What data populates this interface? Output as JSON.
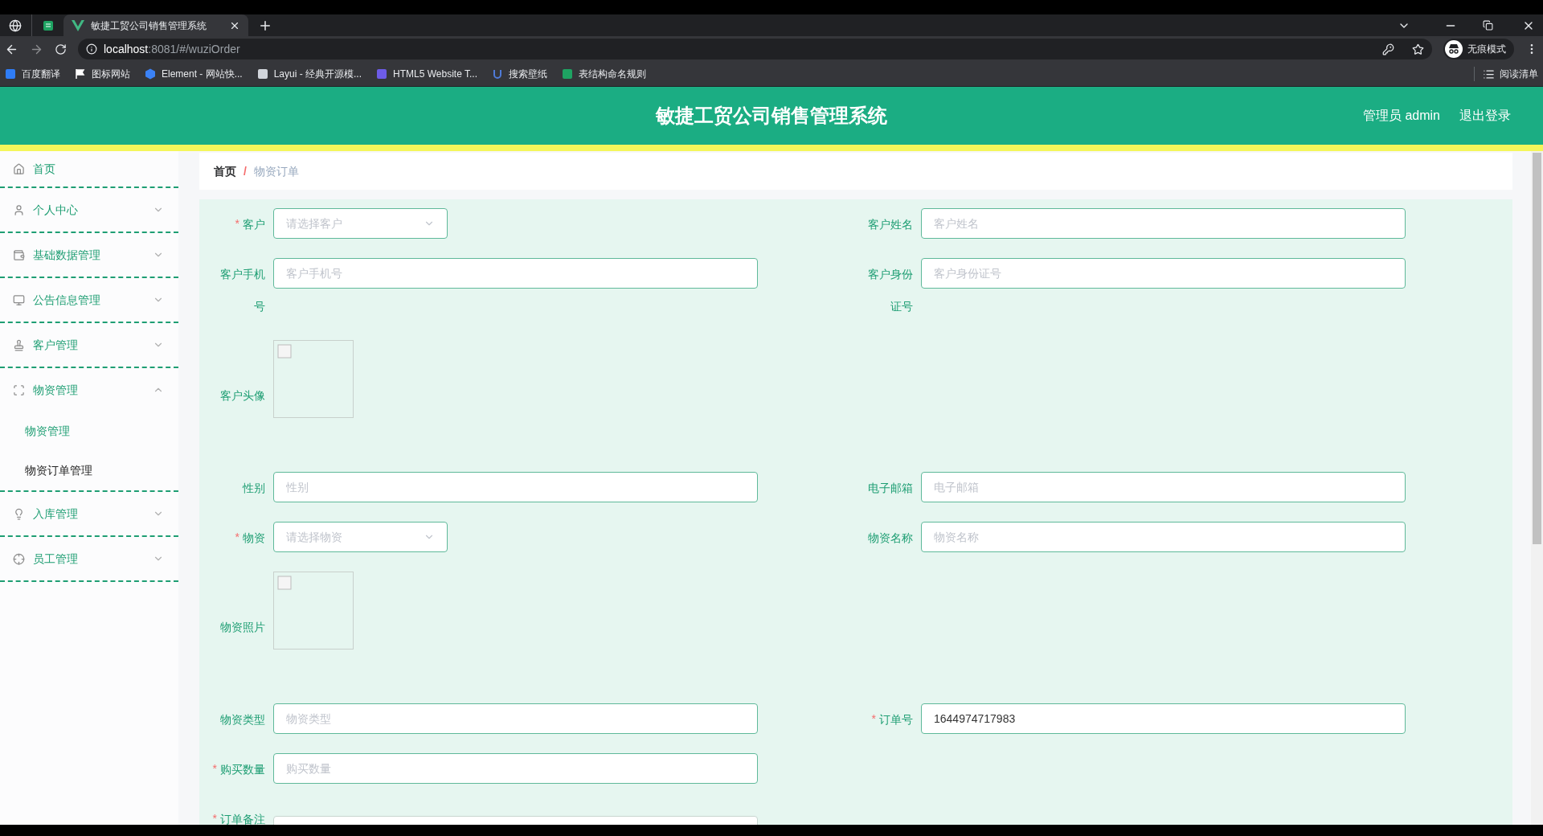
{
  "browser": {
    "tabs": [
      {
        "kind": "pinned",
        "selected": false
      },
      {
        "kind": "page",
        "title": "敏捷工贸公司销售管理系统",
        "selected": true
      }
    ],
    "url_host": "localhost",
    "url_path": ":8081/#/wuziOrder",
    "profile_label": "无痕模式",
    "bookmarks": [
      {
        "label": "百度翻译"
      },
      {
        "label": "图标网站"
      },
      {
        "label": "Element - 网站快..."
      },
      {
        "label": "Layui - 经典开源模..."
      },
      {
        "label": "HTML5 Website T..."
      },
      {
        "label": "搜索壁纸"
      },
      {
        "label": "表结构命名规则"
      }
    ],
    "reading_list": "阅读清单"
  },
  "header": {
    "title": "敏捷工贸公司销售管理系统",
    "user": "管理员 admin",
    "logout": "退出登录"
  },
  "sidebar": {
    "items": [
      {
        "kind": "link",
        "label": "首页"
      },
      {
        "kind": "submenu",
        "label": "个人中心",
        "expanded": false
      },
      {
        "kind": "submenu",
        "label": "基础数据管理",
        "expanded": false
      },
      {
        "kind": "submenu",
        "label": "公告信息管理",
        "expanded": false
      },
      {
        "kind": "submenu",
        "label": "客户管理",
        "expanded": false
      },
      {
        "kind": "submenu",
        "label": "物资管理",
        "expanded": true,
        "children": [
          {
            "label": "物资管理",
            "selected": false
          },
          {
            "label": "物资订单管理",
            "selected": true
          }
        ]
      },
      {
        "kind": "submenu",
        "label": "入库管理",
        "expanded": false
      },
      {
        "kind": "submenu",
        "label": "员工管理",
        "expanded": false
      }
    ]
  },
  "breadcrumb": {
    "items": [
      {
        "label": "首页"
      },
      {
        "label": "物资订单"
      }
    ],
    "separator": "/"
  },
  "form": {
    "required_mark": "*",
    "rows": [
      {
        "left": {
          "kind": "select",
          "label": "客户",
          "required": true,
          "placeholder": "请选择客户"
        },
        "right": {
          "kind": "input",
          "label": "客户姓名",
          "required": false,
          "placeholder": "客户姓名"
        }
      },
      {
        "left": {
          "kind": "input",
          "label": "客户手机号",
          "required": false,
          "placeholder": "客户手机号"
        },
        "right": {
          "kind": "input",
          "label": "客户身份证号",
          "required": false,
          "placeholder": "客户身份证号"
        }
      },
      {
        "left": {
          "kind": "image",
          "label": "客户头像",
          "required": false
        }
      },
      {
        "left": {
          "kind": "input",
          "label": "性别",
          "required": false,
          "placeholder": "性别"
        },
        "right": {
          "kind": "input",
          "label": "电子邮箱",
          "required": false,
          "placeholder": "电子邮箱"
        }
      },
      {
        "left": {
          "kind": "select",
          "label": "物资",
          "required": true,
          "placeholder": "请选择物资"
        },
        "right": {
          "kind": "input",
          "label": "物资名称",
          "required": false,
          "placeholder": "物资名称"
        }
      },
      {
        "left": {
          "kind": "image",
          "label": "物资照片",
          "required": false
        }
      },
      {
        "left": {
          "kind": "input",
          "label": "物资类型",
          "required": false,
          "placeholder": "物资类型"
        },
        "right": {
          "kind": "input",
          "label": "订单号",
          "required": true,
          "value": "1644974717983"
        }
      },
      {
        "left": {
          "kind": "input",
          "label": "购买数量",
          "required": true,
          "placeholder": "购买数量"
        }
      },
      {
        "left": {
          "kind": "textarea",
          "label": "订单备注",
          "required": true
        }
      }
    ]
  }
}
